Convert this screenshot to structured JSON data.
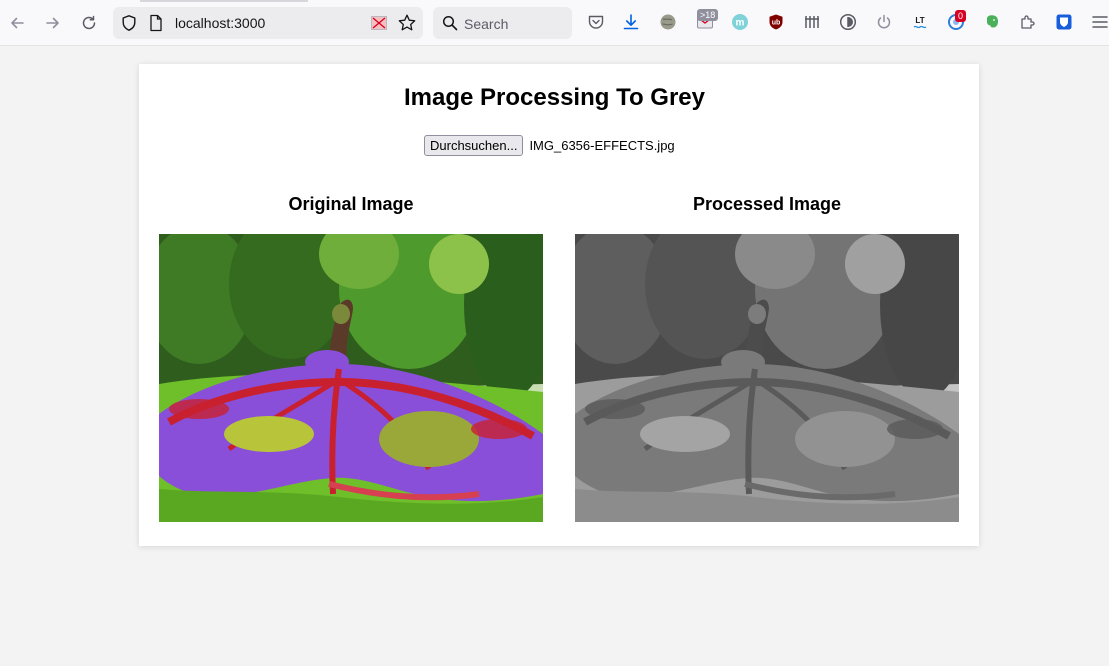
{
  "browser": {
    "url": "localhost:3000",
    "search_placeholder": "Search",
    "mail_badge": ">18",
    "ext_badge": "0",
    "lt_label": "LT"
  },
  "page": {
    "title": "Image Processing To Grey",
    "file_button_label": "Durchsuchen...",
    "file_name": "IMG_6356-EFFECTS.jpg",
    "original_heading": "Original Image",
    "processed_heading": "Processed Image"
  },
  "icons": {
    "back": "arrow-left-icon",
    "forward": "arrow-right-icon",
    "reload": "reload-icon",
    "shield": "shield-icon",
    "page": "page-icon",
    "reader": "reader-view-icon",
    "bookmark": "star-icon",
    "search": "search-icon",
    "pocket": "pocket-icon",
    "download": "download-icon",
    "menu": "hamburger-menu-icon"
  },
  "colors": {
    "page_bg": "#f3f3f3",
    "card_bg": "#ffffff",
    "toolbar_bg": "#f9f9fb",
    "download_blue": "#0061e0",
    "grass_green": "#6fbf2a",
    "flower_purple": "#8a4fd8",
    "flower_red": "#c8202f"
  }
}
